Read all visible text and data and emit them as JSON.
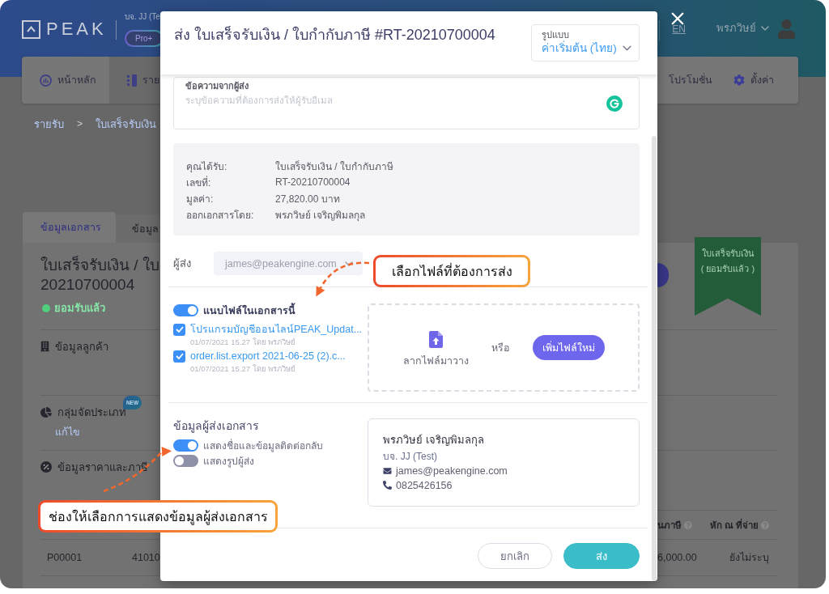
{
  "app": {
    "logo_text": "PEAK",
    "company": "บจ. JJ (Te",
    "plan": "Pro+",
    "language": "EN",
    "user_name": "พรภวิษย์"
  },
  "nav": [
    {
      "label": "หน้าหลัก",
      "selected": false
    },
    {
      "label": "ราย",
      "selected": true
    },
    {
      "label": "โปรโมชั่น",
      "selected": false
    },
    {
      "label": "ตั้งค่า",
      "selected": false
    }
  ],
  "breadcrumb": {
    "items": [
      "รายรับ",
      "ใบเสร็จรับเงิน"
    ],
    "separator": ">"
  },
  "doc_tabs": [
    {
      "label": "ข้อมูลเอกสาร",
      "selected": true
    },
    {
      "label": "ข้อมูล",
      "selected": false
    }
  ],
  "document": {
    "title_lines": [
      "ใบเสร็จรับเงิน / ใบ",
      "20210700004"
    ],
    "status": "ยอมรับแล้ว",
    "ribbon": [
      "ใบเสร็จรับเงิน",
      "( ยอมรับแล้ว )"
    ],
    "sections": [
      {
        "title": "ข้อมูลลูกค้า"
      },
      {
        "title": "กลุ่มจัดประเภท",
        "badge": "NEW",
        "link": "แก้ไข"
      },
      {
        "title": "ข้อมูลราคาและภาษี"
      }
    ],
    "table": {
      "columns": [
        "",
        "",
        "นภาษี",
        "หัก ณ ที่จ่าย"
      ],
      "rows": [
        [
          "P00001",
          "41010",
          "6,000.00",
          "ยังไม่ระบุ"
        ]
      ]
    }
  },
  "modal": {
    "title": "ส่ง ใบเสร็จรับเงิน / ใบกำกับภาษี #RT-20210700004",
    "template": {
      "label": "รูปแบบ",
      "value": "ค่าเริ่มต้น (ไทย)"
    },
    "message": {
      "label": "ข้อความจากผู้ส่ง",
      "placeholder": "ระบุข้อความที่ต้องการส่งให้ผู้รับอีเมล"
    },
    "summary": [
      {
        "label": "คุณได้รับ:",
        "value": "ใบเสร็จรับเงิน / ใบกำกับภาษี"
      },
      {
        "label": "เลขที่:",
        "value": "RT-20210700004"
      },
      {
        "label": "มูลค่า:",
        "value": "27,820.00 บาท"
      },
      {
        "label": "ออกเอกสารโดย:",
        "value": "พรภวิษย์ เจริญพิมลกุล"
      }
    ],
    "sender": {
      "label": "ผู้ส่ง",
      "value": "james@peakengine.com",
      "disabled": true
    },
    "attach": {
      "label": "แนบไฟล์ในเอกสารนี้",
      "on": true,
      "files": [
        {
          "name": "โปรแกรมบัญชีออนไลน์PEAK_Updat...",
          "meta": "01/07/2021 15.27 โดย พรภวิษย์",
          "checked": true
        },
        {
          "name": "order.list.export 2021-06-25 (2).c...",
          "meta": "01/07/2021 15.27 โดย พรภวิษย์",
          "checked": true
        }
      ],
      "drop_hint": "ลากไฟล์มาวาง",
      "or": "หรือ",
      "add_button": "เพิ่มไฟล์ใหม่"
    },
    "sender_info": {
      "title": "ข้อมูลผู้ส่งเอกสาร",
      "options": [
        {
          "label": "แสดงชื่อและข้อมูลติดต่อกลับ",
          "on": true
        },
        {
          "label": "แสดงรูปผู้ส่ง",
          "on": false
        }
      ],
      "card": {
        "name": "พรภวิษย์ เจริญพิมลกุล",
        "company": "บจ. JJ (Test)",
        "email": "james@peakengine.com",
        "phone": "0825426156"
      }
    },
    "buttons": [
      {
        "label": "ยกเลิก",
        "kind": "secondary"
      },
      {
        "label": "ส่ง",
        "kind": "primary"
      }
    ]
  },
  "callouts": [
    {
      "text": "เลือกไฟล์ที่ต้องการส่ง"
    },
    {
      "text": "ช่องให้เลือกการแสดงข้อมูลผู้ส่งเอกสาร"
    }
  ]
}
